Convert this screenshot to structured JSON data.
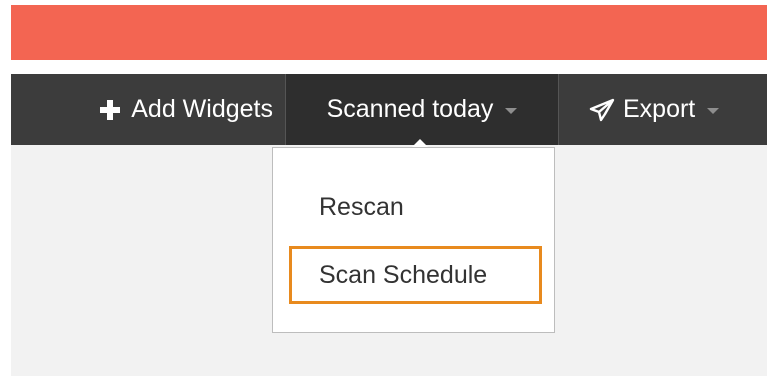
{
  "banner": {
    "color": "#f36552"
  },
  "toolbar": {
    "add_widgets": {
      "label": "Add Widgets",
      "icon": "plus-icon"
    },
    "scanned_today": {
      "label": "Scanned today",
      "icon": "chevron-down-icon"
    },
    "export": {
      "label": "Export",
      "icon": "send-icon",
      "caret_icon": "chevron-down-icon"
    }
  },
  "dropdown": {
    "items": [
      {
        "label": "Rescan"
      },
      {
        "label": "Scan Schedule",
        "highlighted": true
      }
    ],
    "highlight_color": "#e88a1e"
  }
}
